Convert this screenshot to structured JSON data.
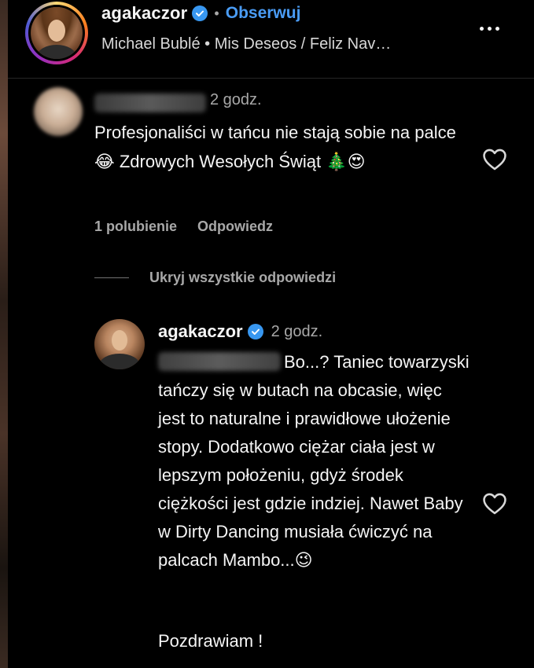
{
  "header": {
    "username": "agakaczor",
    "separator": "•",
    "follow_label": "Obserwuj",
    "subtitle": "Michael Bublé • Mis Deseos / Feliz Nav…",
    "more_icon": "more-horizontal-icon"
  },
  "comment": {
    "time": "2 godz.",
    "text": "Profesjonaliści w tańcu nie stają sobie na palce😂 Zdrowych Wesołych Świąt 🎄😍",
    "likes_label": "1 polubienie",
    "reply_label": "Odpowiedz",
    "hide_replies_label": "Ukryj wszystkie odpowiedzi"
  },
  "reply": {
    "username": "agakaczor",
    "time": "2 godz.",
    "text": "Bo...? Taniec towarzyski tańczy się w butach na obcasie, więc jest to naturalne i prawidłowe ułożenie stopy. Dodatkowo ciężar ciała jest w lepszym położeniu, gdyż środek ciężkości jest gdzie indziej. Nawet Baby w Dirty Dancing musiała ćwiczyć na palcach Mambo...😉",
    "signoff": "Pozdrawiam !"
  },
  "colors": {
    "background": "#000000",
    "text": "#f5f5f5",
    "muted": "#a8a8a8",
    "link": "#4a9cf5",
    "verified": "#3897f0"
  }
}
